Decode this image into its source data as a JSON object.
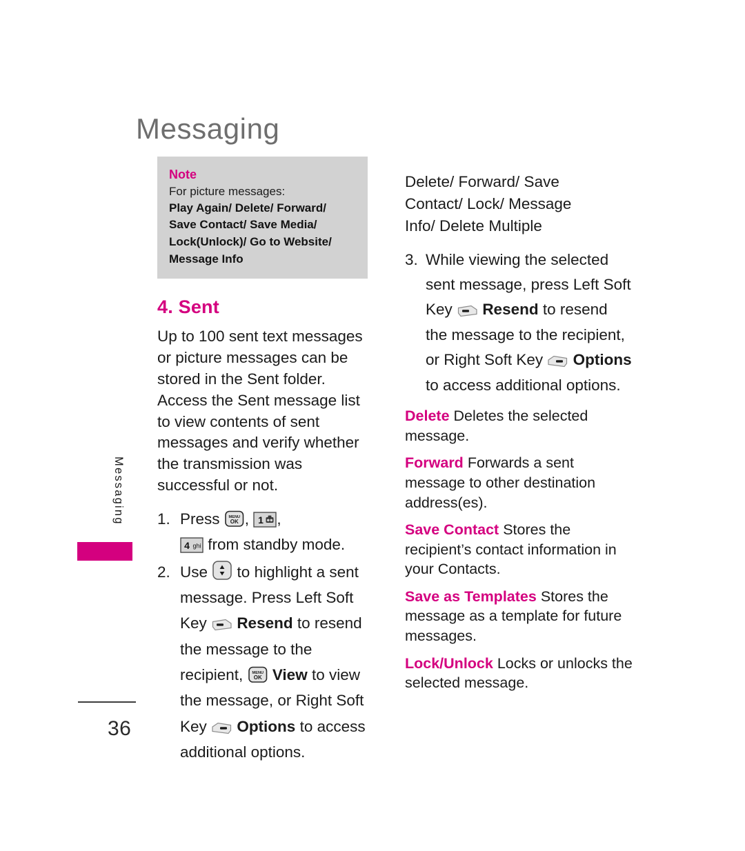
{
  "colors": {
    "accent": "#d4007f",
    "title_gray": "#6e6e6e",
    "note_bg": "#d2d2d2",
    "text": "#1b1b1b"
  },
  "page": {
    "title": "Messaging",
    "number": "36",
    "side_tab_label": "Messaging"
  },
  "note": {
    "title": "Note",
    "intro": "For picture messages:",
    "options": [
      "Play Again/ Delete/ Forward/",
      "Save Contact/ Save Media/",
      "Lock(Unlock)/ Go to Website/",
      "Message Info"
    ]
  },
  "section": {
    "heading": "4. Sent",
    "intro": "Up to 100 sent text messages or picture messages can be stored in the Sent folder. Access the Sent message list to view contents of sent messages and verify whether the transmission was successful or not."
  },
  "steps": [
    {
      "num": "1.",
      "part1": "Press",
      "icon1": "menu-ok-key-icon",
      "sep1": ",",
      "icon2": "number-1-key-icon",
      "sep2": ",",
      "icon3": "number-4-ghi-key-icon",
      "part2": "from standby mode."
    },
    {
      "num": "2.",
      "part1": "Use",
      "icon1": "navigation-up-down-key-icon",
      "part2": "to highlight a sent message. Press Left Soft Key",
      "icon2": "left-soft-key-icon",
      "bold1": "Resend",
      "part3": "to resend the message to the recipient,",
      "icon3": "menu-ok-key-icon",
      "bold2": "View",
      "part4": "to view the message, or",
      "part5": "Right Soft Key",
      "icon4": "right-soft-key-icon",
      "bold3": "Options",
      "part6": "to access additional options."
    }
  ],
  "right_heading": [
    "Delete/ Forward/ Save",
    "Contact/ Lock/ Message",
    "Info/ Delete Multiple"
  ],
  "step3": {
    "num": "3.",
    "part1": "While viewing the selected sent message, press Left Soft Key",
    "icon1": "left-soft-key-icon",
    "bold1": "Resend",
    "part2": "to resend the message to the recipient, or",
    "part3": "Right Soft Key",
    "icon2": "right-soft-key-icon",
    "bold2": "Options",
    "part4": "to access additional options."
  },
  "definitions": [
    {
      "term": "Delete",
      "desc": "Deletes the selected message."
    },
    {
      "term": "Forward",
      "desc": "Forwards a sent message to other destination address(es)."
    },
    {
      "term": "Save Contact",
      "desc": "Stores the recipient’s contact information in your Contacts."
    },
    {
      "term": "Save as Templates",
      "desc": "Stores the message as a template for future messages."
    },
    {
      "term": "Lock/Unlock",
      "desc": "Locks or unlocks the selected message."
    }
  ],
  "key_icons": {
    "menu_ok_top": "MENU",
    "menu_ok_bottom": "OK",
    "number_1": "1",
    "number_4": "4",
    "number_4_letters": "ghi"
  }
}
